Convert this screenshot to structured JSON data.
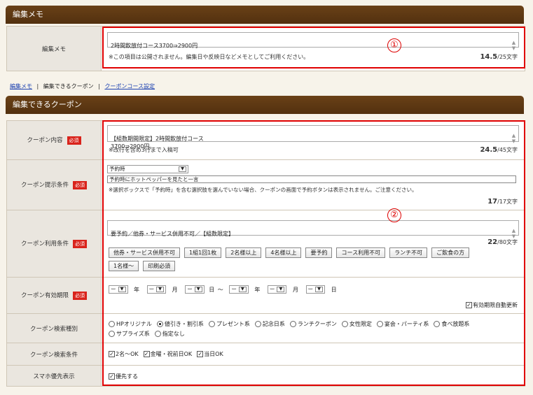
{
  "memo_section": {
    "title": "編集メモ",
    "label": "編集メモ",
    "value": "2時間飲放付コース3700⇒2900円",
    "note": "※この項目は公開されません。編集日や反映日などメモとしてご利用ください。",
    "count_current": "14.5",
    "count_max": "/25文字",
    "annotation": "①"
  },
  "nav_links": {
    "link1": "編集メモ",
    "current": "編集できるクーポン",
    "link2": "クーポンコース設定",
    "sep": "|"
  },
  "coupon_section": {
    "title": "編集できるクーポン",
    "required_label": "必須",
    "annotation": "②",
    "content": {
      "label": "クーポン内容",
      "value": "【組数期間限定】2時間飲放付コース\n3700⇒2900円。",
      "note": "※改行を含め3行まで入稿可",
      "count_current": "24.5",
      "count_max": "/45文字"
    },
    "presentation": {
      "label": "クーポン提示条件",
      "select_value": "予約時",
      "input_value": "予約時にホットペッパーを見たと一言",
      "note": "※選択ボックスで「予約時」を含む選択肢を選んでいない場合、クーポンの画面で予約ボタンは表示されません。ご注意ください。",
      "count_current": "17",
      "count_max": "/17文字"
    },
    "usage": {
      "label": "クーポン利用条件",
      "value": "要予約／他券・サービス併用不可／【組数限定】",
      "count_current": "22",
      "count_max": "/80文字",
      "buttons": [
        "他券・サービス併用不可",
        "1組1回1枚",
        "2名様以上",
        "4名様以上",
        "要予約",
        "コース利用不可",
        "ランチ不可",
        "ご飲食の方",
        "1名様〜",
        "印刷必須"
      ]
    },
    "validity": {
      "label": "クーポン有効期限",
      "dash": "ー",
      "year": "年",
      "month": "月",
      "day": "日",
      "tilde": "〜",
      "auto_update_label": "有効期限自動更新",
      "auto_update_checked": true
    },
    "search_type": {
      "label": "クーポン検索種別",
      "options": [
        "HPオリジナル",
        "値引き・割引系",
        "プレゼント系",
        "記念日系",
        "ランチクーポン",
        "女性限定",
        "宴会・パーティ系",
        "食べ放題系",
        "サプライズ系",
        "指定なし"
      ],
      "selected": "値引き・割引系"
    },
    "search_conditions": {
      "label": "クーポン検索条件",
      "options": [
        "2名〜OK",
        "金曜・祝前日OK",
        "当日OK"
      ]
    },
    "smartphone": {
      "label": "スマホ優先表示",
      "option": "優先する"
    }
  },
  "icons": {
    "check": "✓",
    "scroll_up": "▲",
    "scroll_down": "▼",
    "dropdown": "▼"
  },
  "colors": {
    "header_bg": "#5c3712",
    "required_bg": "#d9231b",
    "annotation_red": "#e00000",
    "link": "#1a3fb0"
  }
}
